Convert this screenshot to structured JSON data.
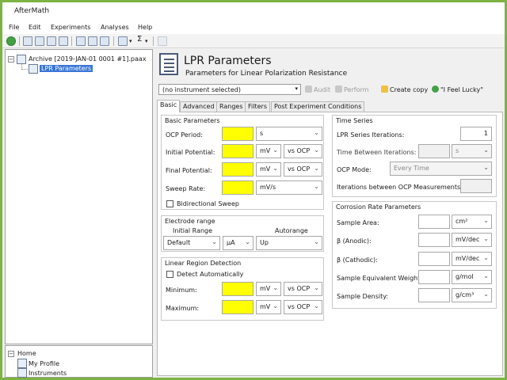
{
  "app": {
    "title": "AfterMath"
  },
  "menu": [
    "File",
    "Edit",
    "Experiments",
    "Analyses",
    "Help"
  ],
  "tree": {
    "archive": "Archive [2019-JAN-01 0001 #1].paax",
    "lpr": "LPR Parameters",
    "home": "Home",
    "profile": "My Profile",
    "instruments": "Instruments"
  },
  "header": {
    "title": "LPR Parameters",
    "subtitle": "Parameters for Linear Polarization Resistance"
  },
  "instrument": {
    "value": "(no instrument selected)"
  },
  "actions": {
    "audit": "Audit",
    "perform": "Perform",
    "create_copy": "Create copy",
    "lucky": "\"I Feel Lucky\""
  },
  "tabs": [
    "Basic",
    "Advanced",
    "Ranges",
    "Filters",
    "Post Experiment Conditions"
  ],
  "basic": {
    "title": "Basic Parameters",
    "ocp_period": "OCP Period:",
    "ocp_unit": "s",
    "initial_potential": "Initial Potential:",
    "final_potential": "Final Potential:",
    "mv": "mV",
    "vs_ocp": "vs OCP",
    "sweep_rate": "Sweep Rate:",
    "sweep_unit": "mV/s",
    "bidirectional": "Bidirectional Sweep"
  },
  "electrode": {
    "title": "Electrode range",
    "initial_range": "Initial Range",
    "autorange": "Autorange",
    "default": "Default",
    "ua": "µA",
    "up": "Up"
  },
  "linear": {
    "title": "Linear Region Detection",
    "detect": "Detect Automatically",
    "minimum": "Minimum:",
    "maximum": "Maximum:",
    "mv": "mV",
    "vs_ocp": "vs OCP"
  },
  "timeseries": {
    "title": "Time Series",
    "iterations": "LPR Series Iterations:",
    "iterations_value": "1",
    "between": "Time Between Iterations:",
    "between_unit": "s",
    "ocp_mode": "OCP Mode:",
    "ocp_mode_value": "Every Time",
    "iter_between_ocp": "Iterations between OCP Measurements:"
  },
  "corrosion": {
    "title": "Corrosion Rate Parameters",
    "area": "Sample Area:",
    "area_unit": "cm²",
    "anodic": "β (Anodic):",
    "cathodic": "β (Cathodic):",
    "beta_unit": "mV/dec",
    "weight": "Sample Equivalent Weight:",
    "weight_unit": "g/mol",
    "density": "Sample Density:",
    "density_unit": "g/cm³"
  },
  "colors": {
    "frame": "#7cb342",
    "required": "#ffff00",
    "selection": "#3875d7"
  }
}
